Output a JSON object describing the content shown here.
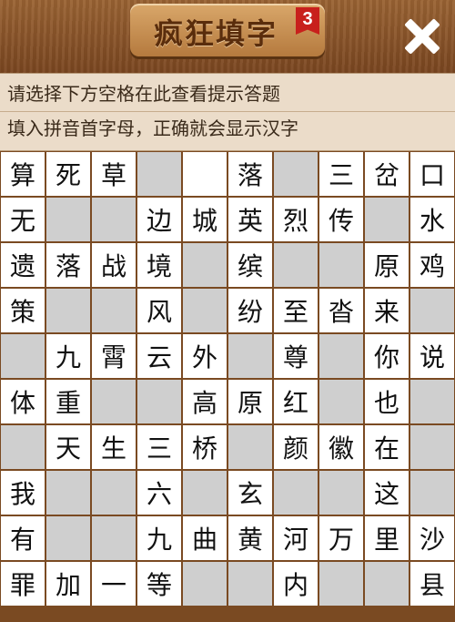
{
  "header": {
    "title": "疯狂填字",
    "level_badge": "3",
    "close_icon": "close-icon"
  },
  "hints": {
    "line1": "请选择下方空格在此查看提示答题",
    "line2": "填入拼音首字母，正确就会显示汉字"
  },
  "board": {
    "cols": 10,
    "rows": 10,
    "cells": [
      [
        "算",
        "死",
        "草",
        "#",
        "",
        "落",
        "#",
        "三",
        "岔",
        "口"
      ],
      [
        "无",
        "#",
        "#",
        "边",
        "城",
        "英",
        "烈",
        "传",
        "#",
        "水"
      ],
      [
        "遗",
        "落",
        "战",
        "境",
        "#",
        "缤",
        "#",
        "#",
        "原",
        "鸡"
      ],
      [
        "策",
        "#",
        "#",
        "风",
        "#",
        "纷",
        "至",
        "沓",
        "来",
        "#"
      ],
      [
        "#",
        "九",
        "霄",
        "云",
        "外",
        "#",
        "尊",
        "#",
        "你",
        "说"
      ],
      [
        "体",
        "重",
        "#",
        "#",
        "高",
        "原",
        "红",
        "#",
        "也",
        "#"
      ],
      [
        "#",
        "天",
        "生",
        "三",
        "桥",
        "#",
        "颜",
        "徽",
        "在",
        "#"
      ],
      [
        "我",
        "#",
        "#",
        "六",
        "#",
        "玄",
        "#",
        "#",
        "这",
        "#"
      ],
      [
        "有",
        "#",
        "#",
        "九",
        "曲",
        "黄",
        "河",
        "万",
        "里",
        "沙"
      ],
      [
        "罪",
        "加",
        "一",
        "等",
        "#",
        "#",
        "内",
        "#",
        "#",
        "县"
      ]
    ]
  }
}
